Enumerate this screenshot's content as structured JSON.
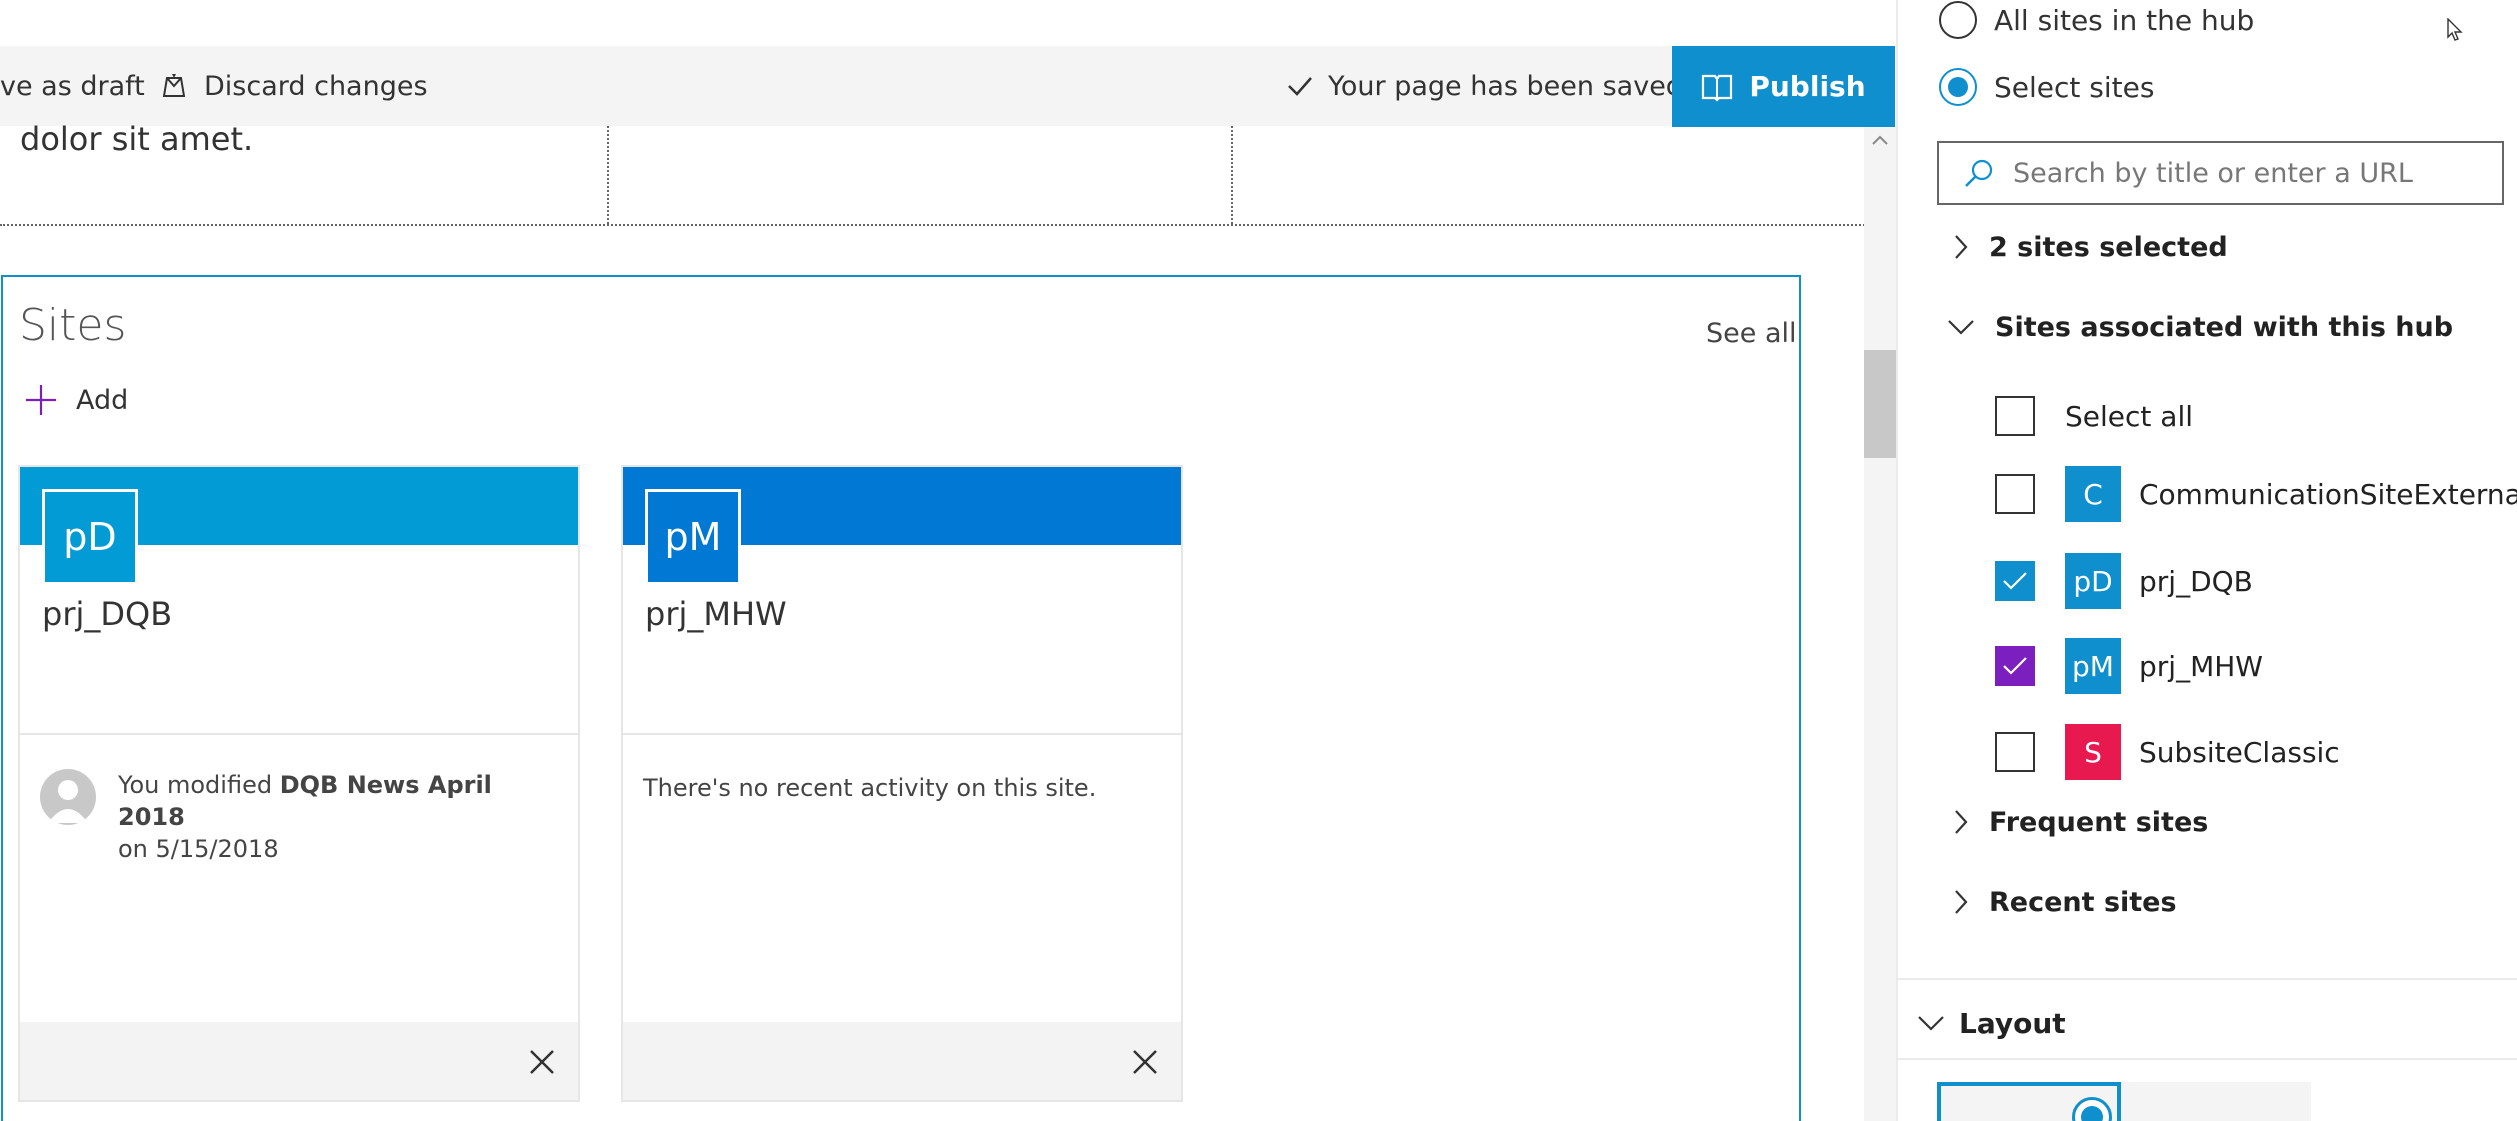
{
  "toolbar": {
    "save_draft_label": "ve as draft",
    "discard_label": "Discard changes",
    "status_text": "Your page has been saved",
    "publish_label": "Publish"
  },
  "canvas": {
    "text_fragment": "dolor sit amet."
  },
  "webpart": {
    "title": "Sites",
    "see_all": "See all",
    "add_label": "Add",
    "cards": [
      {
        "initials": "pD",
        "name": "prj_DQB",
        "banner_color": "#039bd6",
        "activity_prefix": "You modified ",
        "activity_bold": "DQB News April 2018",
        "activity_suffix": "on 5/15/2018"
      },
      {
        "initials": "pM",
        "name": "prj_MHW",
        "banner_color": "#0078d4",
        "activity": "There's no recent activity on this site."
      }
    ]
  },
  "panel": {
    "scope_options": [
      {
        "label": "All sites in the hub",
        "selected": false
      },
      {
        "label": "Select sites",
        "selected": true
      }
    ],
    "search_placeholder": "Search by title or enter a URL",
    "selected_group": "2 sites selected",
    "hub_group": "Sites associated with this hub",
    "select_all": "Select all",
    "sites": [
      {
        "initial": "C",
        "name": "CommunicationSiteExternal",
        "color": "#0f8fce",
        "checked": false
      },
      {
        "initial": "pD",
        "name": "prj_DQB",
        "color": "#0f8fce",
        "checked": true,
        "check_color": "#0f8fce"
      },
      {
        "initial": "pM",
        "name": "prj_MHW",
        "color": "#0f8fce",
        "checked": true,
        "check_color": "#7b1fbf"
      },
      {
        "initial": "S",
        "name": "SubsiteClassic",
        "color": "#e8194e",
        "checked": false
      }
    ],
    "frequent_group": "Frequent sites",
    "recent_group": "Recent sites",
    "layout_section": "Layout"
  },
  "colors": {
    "accent": "#0f8fce",
    "purple": "#7b1fbf",
    "toolbar_bg": "#f4f4f4"
  }
}
